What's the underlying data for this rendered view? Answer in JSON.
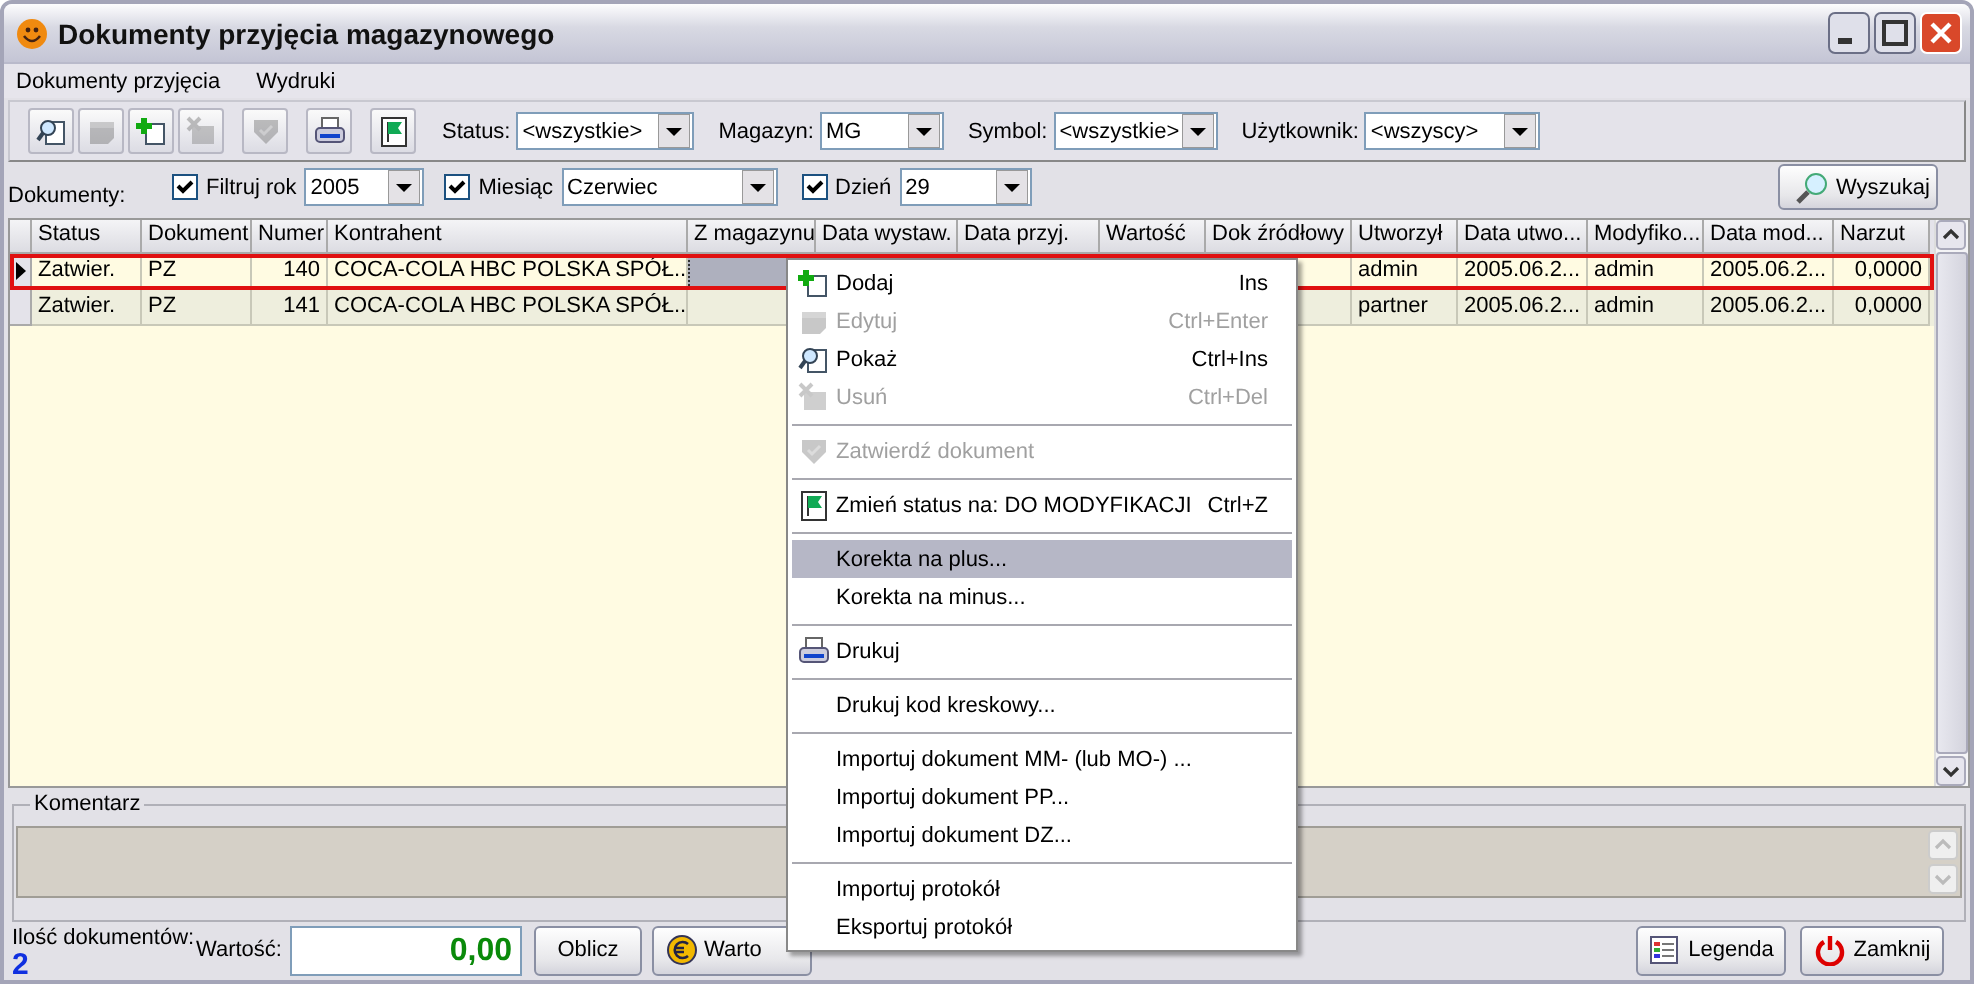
{
  "window": {
    "title": "Dokumenty przyjęcia magazynowego"
  },
  "menu_bar": [
    "Dokumenty przyjęcia",
    "Wydruki"
  ],
  "toolbar": {
    "buttons": [
      {
        "disabled": false
      },
      {
        "disabled": true
      },
      {
        "disabled": false
      },
      {
        "disabled": true
      },
      {
        "disabled": true
      },
      {
        "disabled": false
      },
      {
        "disabled": false
      }
    ],
    "filters": [
      {
        "label": "Status:",
        "value": "<wszystkie>"
      },
      {
        "label": "Magazyn:",
        "value": "MG"
      },
      {
        "label": "Symbol:",
        "value": "<wszystkie>"
      },
      {
        "label": "Użytkownik:",
        "value": "<wszyscy>"
      }
    ]
  },
  "filter_row": {
    "label": "Dokumenty:",
    "filters": [
      {
        "label": "Filtruj rok",
        "checked": true,
        "value": "2005"
      },
      {
        "label": "Miesiąc",
        "checked": true,
        "value": "Czerwiec"
      },
      {
        "label": "Dzień",
        "checked": true,
        "value": "29"
      }
    ],
    "search_button": "Wyszukaj"
  },
  "table": {
    "columns": [
      {
        "label": "Status",
        "focused": false
      },
      {
        "label": "Dokument",
        "focused": false
      },
      {
        "label": "Numer",
        "focused": false
      },
      {
        "label": "Kontrahent",
        "focused": false
      },
      {
        "label": "Z magazynu",
        "focused": true
      },
      {
        "label": "Data wystaw.",
        "focused": false
      },
      {
        "label": "Data przyj.",
        "focused": false
      },
      {
        "label": "Wartość",
        "focused": false
      },
      {
        "label": "Dok źródłowy",
        "focused": false
      },
      {
        "label": "Utworzył",
        "focused": false
      },
      {
        "label": "Data utwo...",
        "focused": false
      },
      {
        "label": "Modyfiko...",
        "focused": false
      },
      {
        "label": "Data mod...",
        "focused": false
      },
      {
        "label": "Narzut",
        "focused": false
      }
    ],
    "rows": [
      {
        "selected": true,
        "cells": [
          "Zatwier.",
          "PZ",
          "140",
          "COCA-COLA HBC POLSKA SPÓŁ...",
          null,
          null,
          null,
          null,
          null,
          "admin",
          "2005.06.2...",
          "admin",
          "2005.06.2...",
          "0,0000"
        ]
      },
      {
        "selected": false,
        "cells": [
          "Zatwier.",
          "PZ",
          "141",
          "COCA-COLA HBC POLSKA SPÓŁ...",
          null,
          null,
          null,
          null,
          null,
          "partner",
          "2005.06.2...",
          "admin",
          "2005.06.2...",
          "0,0000"
        ]
      }
    ]
  },
  "comment": {
    "label": "Komentarz"
  },
  "footer": {
    "count_label": "Ilość dokumentów:",
    "count": "2",
    "value_label": "Wartość:",
    "value": "0,00",
    "buttons": [
      "Oblicz",
      "Warto",
      "Legenda",
      "Zamknij"
    ]
  },
  "context_menu": {
    "groups": [
      [
        {
          "label": "Dodaj",
          "shortcut": "Ins",
          "disabled": false,
          "selected": false
        },
        {
          "label": "Edytuj",
          "shortcut": "Ctrl+Enter",
          "disabled": true,
          "selected": false
        },
        {
          "label": "Pokaż",
          "shortcut": "Ctrl+Ins",
          "disabled": false,
          "selected": false
        },
        {
          "label": "Usuń",
          "shortcut": "Ctrl+Del",
          "disabled": true,
          "selected": false
        }
      ],
      [
        {
          "label": "Zatwierdź dokument",
          "disabled": true,
          "selected": false
        }
      ],
      [
        {
          "label": "Zmień status na: DO MODYFIKACJI",
          "shortcut": "Ctrl+Z",
          "disabled": false,
          "selected": false
        }
      ],
      [
        {
          "label": "Korekta na plus...",
          "disabled": false,
          "selected": true
        },
        {
          "label": "Korekta na minus...",
          "disabled": false,
          "selected": false
        }
      ],
      [
        {
          "label": "Drukuj",
          "disabled": false,
          "selected": false
        }
      ],
      [
        {
          "label": "Drukuj kod kreskowy...",
          "disabled": false,
          "selected": false
        }
      ],
      [
        {
          "label": "Importuj dokument MM- (lub MO-) ...",
          "disabled": false,
          "selected": false
        },
        {
          "label": "Importuj dokument PP...",
          "disabled": false,
          "selected": false
        },
        {
          "label": "Importuj dokument DZ...",
          "disabled": false,
          "selected": false
        }
      ],
      [
        {
          "label": "Importuj protokół",
          "disabled": false,
          "selected": false
        },
        {
          "label": "Eksportuj protokół",
          "disabled": false,
          "selected": false
        }
      ]
    ]
  }
}
